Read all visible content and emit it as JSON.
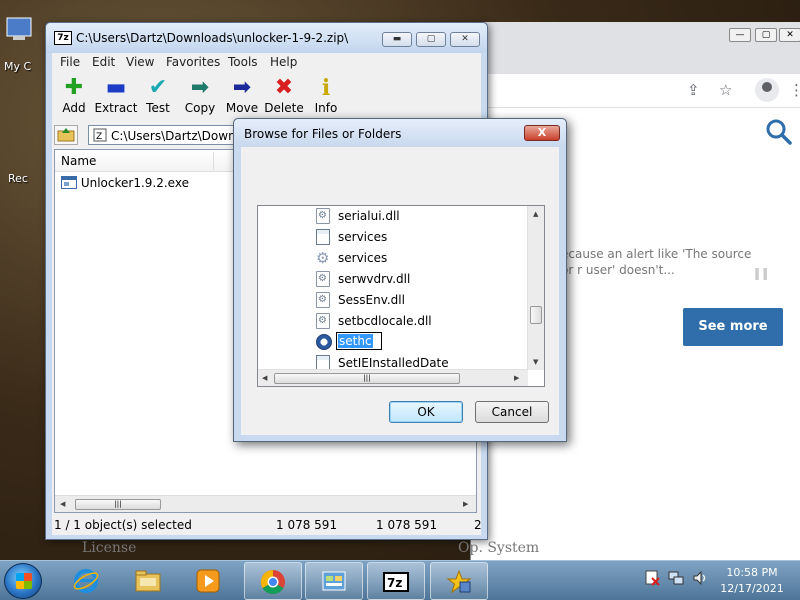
{
  "desktop": {
    "label_my": "My C",
    "label_rec": "Rec"
  },
  "chrome": {
    "quote": "ecause an alert like 'The source or r user' doesn't...",
    "see_more": "See more"
  },
  "zip": {
    "title": "C:\\Users\\Dartz\\Downloads\\unlocker-1-9-2.zip\\",
    "menu": [
      "File",
      "Edit",
      "View",
      "Favorites",
      "Tools",
      "Help"
    ],
    "tools": [
      {
        "label": "Add",
        "icon": "plus-icon"
      },
      {
        "label": "Extract",
        "icon": "minus-icon"
      },
      {
        "label": "Test",
        "icon": "check-icon"
      },
      {
        "label": "Copy",
        "icon": "copy-arrow-icon"
      },
      {
        "label": "Move",
        "icon": "move-arrow-icon"
      },
      {
        "label": "Delete",
        "icon": "delete-x-icon"
      },
      {
        "label": "Info",
        "icon": "info-icon"
      }
    ],
    "address": "C:\\Users\\Dartz\\Downlo",
    "column_name": "Name",
    "files": [
      "Unlocker1.9.2.exe"
    ],
    "status": {
      "selected": "1 / 1 object(s) selected",
      "size": "1 078 591",
      "packed": "1 078 591",
      "extra": "2"
    }
  },
  "dialog": {
    "title": "Browse for Files or Folders",
    "close": "X",
    "items": [
      {
        "label": "serialui.dll",
        "icon": "dll-icon"
      },
      {
        "label": "services",
        "icon": "exe-icon"
      },
      {
        "label": "services",
        "icon": "gear-icon"
      },
      {
        "label": "serwvdrv.dll",
        "icon": "dll-icon"
      },
      {
        "label": "SessEnv.dll",
        "icon": "dll-icon"
      },
      {
        "label": "setbcdlocale.dll",
        "icon": "dll-icon"
      },
      {
        "label": "sethc",
        "icon": "clock-icon",
        "editing": true
      },
      {
        "label": "SetIEInstalledDate",
        "icon": "exe-icon"
      }
    ],
    "ok": "OK",
    "cancel": "Cancel"
  },
  "web_peek": {
    "left": "License",
    "right": "Op. System"
  },
  "taskbar": {
    "time": "10:58 PM",
    "date": "12/17/2021"
  }
}
